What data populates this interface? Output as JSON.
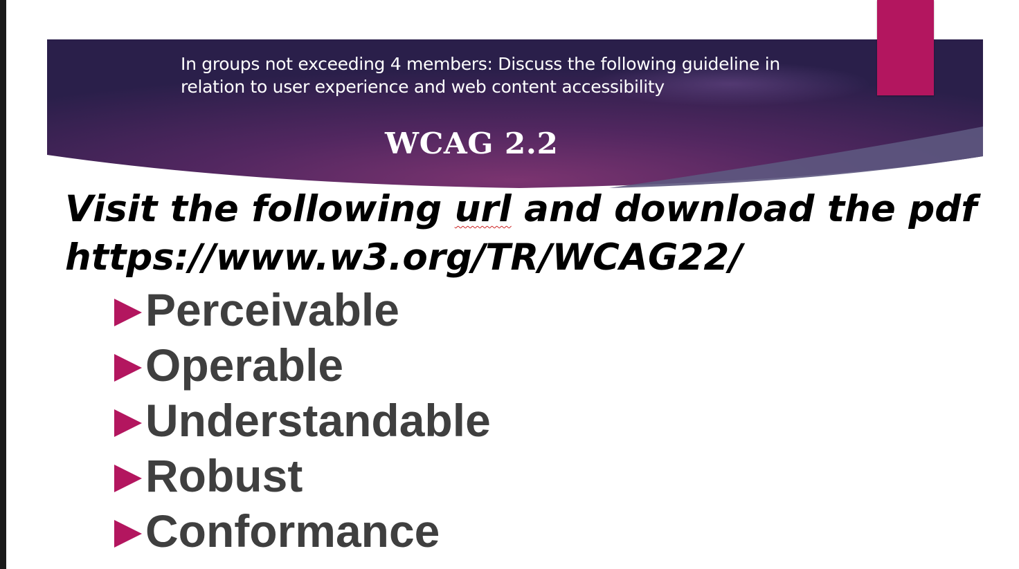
{
  "slide": {
    "banner": {
      "instruction_line_1": "In groups not exceeding 4 members: Discuss the following guideline in",
      "instruction_line_2": "relation to user experience and web content accessibility",
      "title": "WCAG 2.2"
    },
    "visit": {
      "line1_before": "Visit the following ",
      "line1_url_word": "url",
      "line1_after": " and download the pdf",
      "line2": "https://www.w3.org/TR/WCAG22/"
    },
    "bullets": [
      {
        "label": "Perceivable"
      },
      {
        "label": "Operable"
      },
      {
        "label": "Understandable"
      },
      {
        "label": "Robust"
      },
      {
        "label": "Conformance"
      }
    ]
  },
  "colors": {
    "banner_dark": "#2a1f4a",
    "banner_mid": "#5a2a5e",
    "accent": "#b3165f",
    "bullet_text": "#3f3f3f",
    "body_text": "#000000"
  },
  "icons": {
    "bullet": "play-triangle-icon"
  }
}
